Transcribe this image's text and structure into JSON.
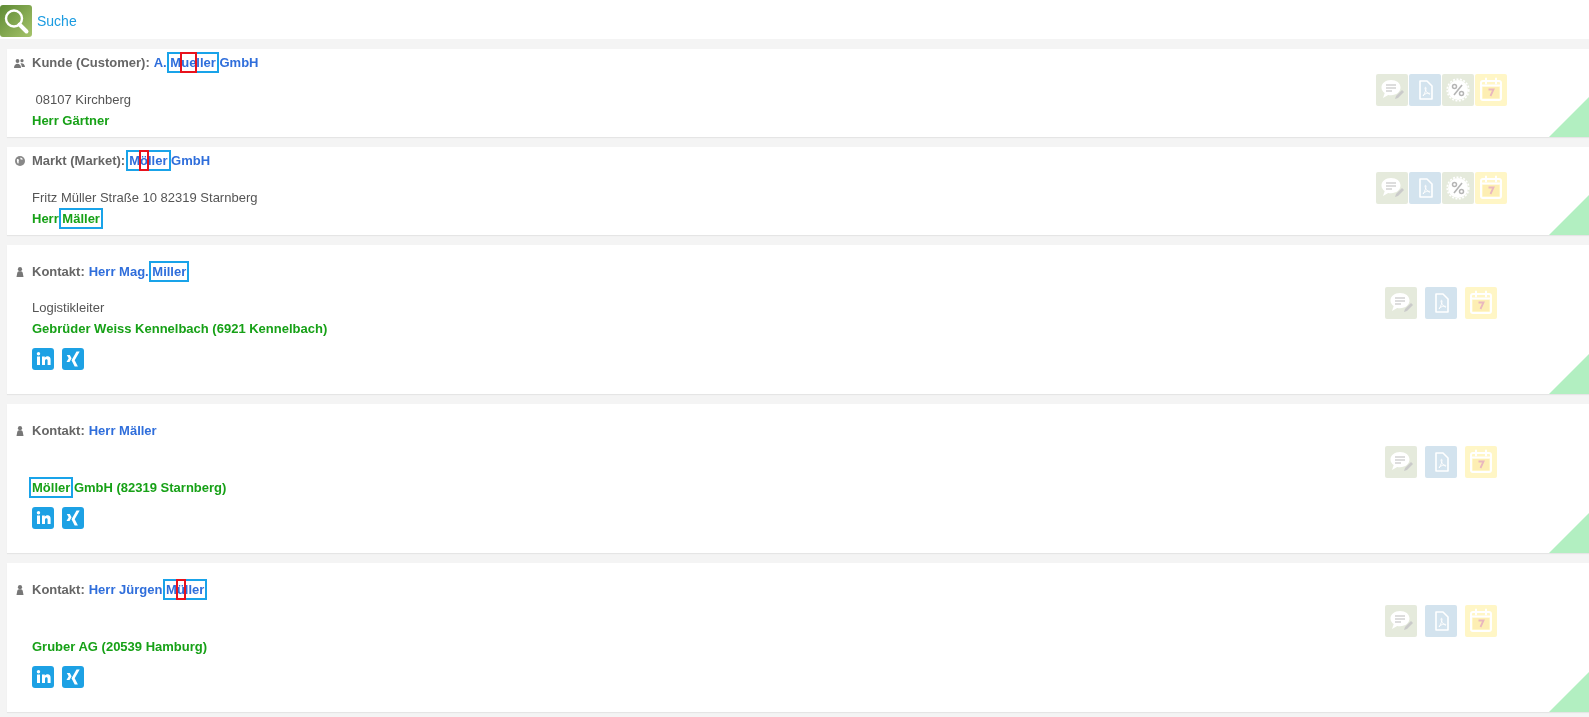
{
  "search": {
    "label": "Suche"
  },
  "cards": [
    {
      "kind": "customer",
      "label": "Kunde (Customer):",
      "name": [
        {
          "kind": "plain",
          "text": "A. "
        },
        {
          "kind": "match",
          "parts": [
            {
              "kind": "plain",
              "text": "M"
            },
            {
              "kind": "mismatch",
              "text": "ue"
            },
            {
              "kind": "plain",
              "text": "ller"
            }
          ]
        },
        {
          "kind": "plain",
          "text": " GmbH"
        }
      ],
      "detail": " 08107 Kirchberg",
      "relation": [
        {
          "kind": "plain",
          "text": "Herr Gärtner"
        }
      ],
      "actions": [
        {
          "kind": "comment"
        },
        {
          "kind": "pdf"
        },
        {
          "kind": "percent"
        },
        {
          "kind": "calendar"
        }
      ]
    },
    {
      "kind": "market",
      "label": "Markt (Market):",
      "name": [
        {
          "kind": "match",
          "parts": [
            {
              "kind": "plain",
              "text": "M"
            },
            {
              "kind": "mismatch",
              "text": "ö"
            },
            {
              "kind": "plain",
              "text": "ller"
            }
          ]
        },
        {
          "kind": "plain",
          "text": " GmbH"
        }
      ],
      "detail": "Fritz Müller Straße 10 82319 Starnberg",
      "relation": [
        {
          "kind": "plain",
          "text": "Herr "
        },
        {
          "kind": "match",
          "parts": [
            {
              "kind": "plain",
              "text": "Mäller"
            }
          ]
        }
      ],
      "actions": [
        {
          "kind": "comment"
        },
        {
          "kind": "pdf"
        },
        {
          "kind": "percent"
        },
        {
          "kind": "calendar"
        }
      ]
    },
    {
      "kind": "contact",
      "label": "Kontakt:",
      "name": [
        {
          "kind": "plain",
          "text": "Herr Mag. "
        },
        {
          "kind": "match",
          "parts": [
            {
              "kind": "plain",
              "text": "Miller"
            }
          ]
        }
      ],
      "detail": "Logistikleiter",
      "relation": [
        {
          "kind": "plain",
          "text": "Gebrüder Weiss Kennelbach (6921 Kennelbach)"
        }
      ],
      "social": [
        {
          "kind": "linkedin"
        },
        {
          "kind": "xing"
        }
      ],
      "actions": [
        {
          "kind": "comment"
        },
        {
          "kind": "pdf"
        },
        {
          "kind": "calendar"
        }
      ]
    },
    {
      "kind": "contact",
      "label": "Kontakt:",
      "name": [
        {
          "kind": "plain",
          "text": "Herr Mäller"
        }
      ],
      "relation": [
        {
          "kind": "match",
          "parts": [
            {
              "kind": "plain",
              "text": "Möller"
            }
          ]
        },
        {
          "kind": "plain",
          "text": " GmbH (82319 Starnberg)"
        }
      ],
      "social": [
        {
          "kind": "linkedin"
        },
        {
          "kind": "xing"
        }
      ],
      "actions": [
        {
          "kind": "comment"
        },
        {
          "kind": "pdf"
        },
        {
          "kind": "calendar"
        }
      ]
    },
    {
      "kind": "contact",
      "label": "Kontakt:",
      "name": [
        {
          "kind": "plain",
          "text": "Herr Jürgen "
        },
        {
          "kind": "match",
          "parts": [
            {
              "kind": "plain",
              "text": "M"
            },
            {
              "kind": "mismatch",
              "text": "ü"
            },
            {
              "kind": "plain",
              "text": "ller"
            }
          ]
        }
      ],
      "relation": [
        {
          "kind": "plain",
          "text": "Gruber AG (20539 Hamburg)"
        }
      ],
      "social": [
        {
          "kind": "linkedin"
        },
        {
          "kind": "xing"
        }
      ],
      "actions": [
        {
          "kind": "comment"
        },
        {
          "kind": "pdf"
        },
        {
          "kind": "calendar"
        }
      ]
    }
  ]
}
